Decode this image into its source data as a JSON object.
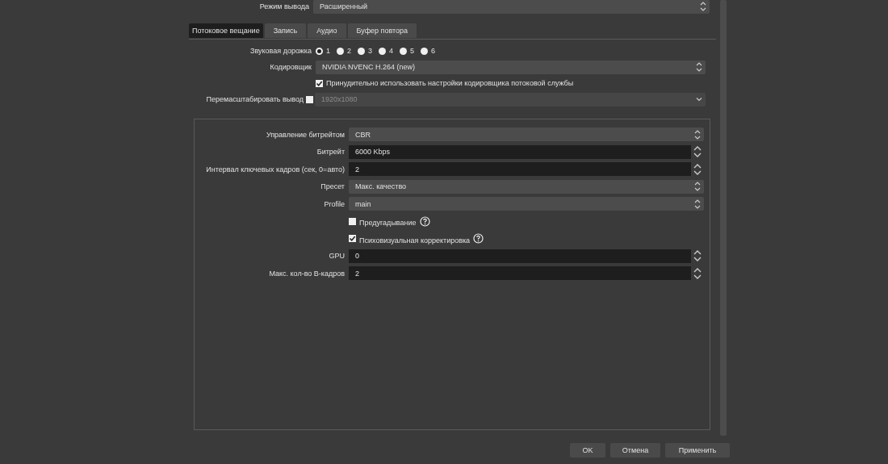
{
  "output_mode": {
    "label": "Режим вывода",
    "value": "Расширенный"
  },
  "tabs": [
    {
      "label": "Потоковое вещание",
      "selected": true
    },
    {
      "label": "Запись",
      "selected": false
    },
    {
      "label": "Аудио",
      "selected": false
    },
    {
      "label": "Буфер повтора",
      "selected": false
    }
  ],
  "audio_track": {
    "label": "Звуковая дорожка",
    "options": [
      {
        "label": "1",
        "selected": true
      },
      {
        "label": "2",
        "selected": false
      },
      {
        "label": "3",
        "selected": false
      },
      {
        "label": "4",
        "selected": false
      },
      {
        "label": "5",
        "selected": false
      },
      {
        "label": "6",
        "selected": false
      }
    ]
  },
  "encoder": {
    "label": "Кодировщик",
    "value": "NVIDIA NVENC H.264 (new)"
  },
  "force_settings": {
    "label": "Принудительно использовать настройки кодировщика потоковой службы",
    "checked": true
  },
  "rescale": {
    "label": "Перемасштабировать вывод",
    "checked": false,
    "value": "1920x1080",
    "disabled": true
  },
  "encoder_settings": [
    {
      "kind": "combo",
      "label": "Управление битрейтом",
      "value": "CBR"
    },
    {
      "kind": "spin",
      "label": "Битрейт",
      "value": "6000 Kbps"
    },
    {
      "kind": "spin",
      "label": "Интервал ключевых кадров (сек, 0=авто)",
      "value": "2"
    },
    {
      "kind": "combo",
      "label": "Пресет",
      "value": "Макс. качество"
    },
    {
      "kind": "combo",
      "label": "Profile",
      "value": "main"
    },
    {
      "kind": "check",
      "label": "Предугадывание",
      "checked": false,
      "help": true
    },
    {
      "kind": "check",
      "label": "Психовизуальная корректировка",
      "checked": true,
      "help": true
    },
    {
      "kind": "spin",
      "label": "GPU",
      "value": "0"
    },
    {
      "kind": "spin",
      "label": "Макс. кол-во B-кадров",
      "value": "2"
    }
  ],
  "buttons": [
    "OK",
    "Отмена",
    "Применить"
  ]
}
